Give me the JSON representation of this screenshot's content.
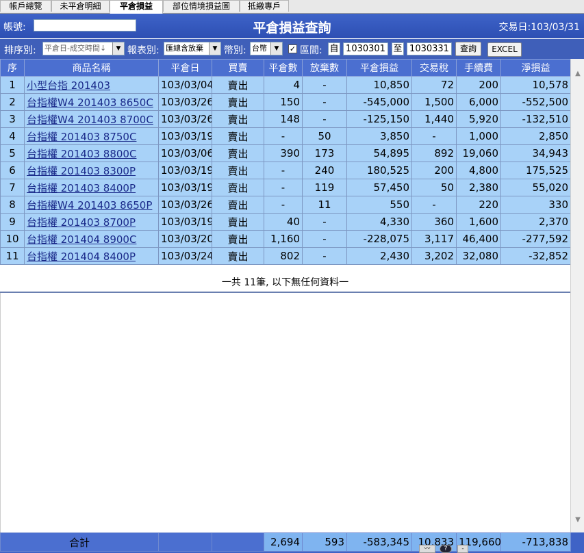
{
  "tabs": [
    {
      "label": "帳戶總覽",
      "active": false
    },
    {
      "label": "未平倉明細",
      "active": false
    },
    {
      "label": "平倉損益",
      "active": true
    },
    {
      "label": "部位情境損益圖",
      "active": false
    },
    {
      "label": "抵繳專戶",
      "active": false
    }
  ],
  "header": {
    "account_label": "帳號:",
    "account_value": "",
    "title": "平倉損益查詢",
    "trade_date_label": "交易日:",
    "trade_date": "103/03/31"
  },
  "filters": {
    "sort_label": "排序別:",
    "sort_value": "平倉日-成交時間↓",
    "report_label": "報表別:",
    "report_value": "匯總含放棄",
    "currency_label": "幣別:",
    "currency_value": "台幣",
    "range_label": "區間:",
    "from_label": "自",
    "from_value": "1030301",
    "to_label": "至",
    "to_value": "1030331",
    "query_button": "查詢",
    "excel_button": "EXCEL"
  },
  "table": {
    "headers": [
      "序",
      "商品名稱",
      "平倉日",
      "買賣",
      "平倉數",
      "放棄數",
      "平倉損益",
      "交易稅",
      "手續費",
      "淨損益"
    ],
    "rows": [
      [
        "1",
        "小型台指 201403",
        "103/03/04",
        "賣出",
        "4",
        "-",
        "10,850",
        "72",
        "200",
        "10,578"
      ],
      [
        "2",
        "台指權W4 201403 8650C",
        "103/03/26",
        "賣出",
        "150",
        "-",
        "-545,000",
        "1,500",
        "6,000",
        "-552,500"
      ],
      [
        "3",
        "台指權W4 201403 8700C",
        "103/03/26",
        "賣出",
        "148",
        "-",
        "-125,150",
        "1,440",
        "5,920",
        "-132,510"
      ],
      [
        "4",
        "台指權 201403 8750C",
        "103/03/19",
        "賣出",
        "-",
        "50",
        "3,850",
        "-",
        "1,000",
        "2,850"
      ],
      [
        "5",
        "台指權 201403 8800C",
        "103/03/06",
        "賣出",
        "390",
        "173",
        "54,895",
        "892",
        "19,060",
        "34,943"
      ],
      [
        "6",
        "台指權 201403 8300P",
        "103/03/19",
        "賣出",
        "-",
        "240",
        "180,525",
        "200",
        "4,800",
        "175,525"
      ],
      [
        "7",
        "台指權 201403 8400P",
        "103/03/19",
        "賣出",
        "-",
        "119",
        "57,450",
        "50",
        "2,380",
        "55,020"
      ],
      [
        "8",
        "台指權W4 201403 8650P",
        "103/03/26",
        "賣出",
        "-",
        "11",
        "550",
        "-",
        "220",
        "330"
      ],
      [
        "9",
        "台指權 201403 8700P",
        "103/03/19",
        "賣出",
        "40",
        "-",
        "4,330",
        "360",
        "1,600",
        "2,370"
      ],
      [
        "10",
        "台指權 201404 8900C",
        "103/03/20",
        "賣出",
        "1,160",
        "-",
        "-228,075",
        "3,117",
        "46,400",
        "-277,592"
      ],
      [
        "11",
        "台指權 201404 8400P",
        "103/03/24",
        "賣出",
        "802",
        "-",
        "2,430",
        "3,202",
        "32,080",
        "-32,852"
      ]
    ]
  },
  "footer_note": "一共 11筆, 以下無任何資料一",
  "totals": {
    "label": "合計",
    "close_qty": "2,694",
    "abandon_qty": "593",
    "close_pnl": "-583,345",
    "tax": "10,833",
    "fee": "119,660",
    "net": "-713,838"
  },
  "icons": [
    "scroll-up-icon",
    "scroll-down-icon",
    "chart-icon",
    "help-icon",
    "minimize-icon"
  ]
}
